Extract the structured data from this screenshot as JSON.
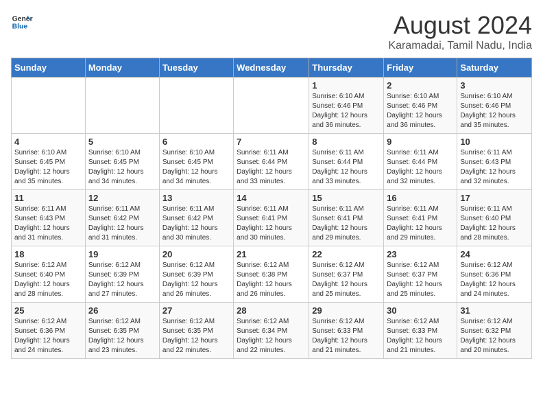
{
  "logo": {
    "line1": "General",
    "line2": "Blue"
  },
  "title": "August 2024",
  "subtitle": "Karamadai, Tamil Nadu, India",
  "days_of_week": [
    "Sunday",
    "Monday",
    "Tuesday",
    "Wednesday",
    "Thursday",
    "Friday",
    "Saturday"
  ],
  "weeks": [
    [
      {
        "day": "",
        "detail": ""
      },
      {
        "day": "",
        "detail": ""
      },
      {
        "day": "",
        "detail": ""
      },
      {
        "day": "",
        "detail": ""
      },
      {
        "day": "1",
        "detail": "Sunrise: 6:10 AM\nSunset: 6:46 PM\nDaylight: 12 hours\nand 36 minutes."
      },
      {
        "day": "2",
        "detail": "Sunrise: 6:10 AM\nSunset: 6:46 PM\nDaylight: 12 hours\nand 36 minutes."
      },
      {
        "day": "3",
        "detail": "Sunrise: 6:10 AM\nSunset: 6:46 PM\nDaylight: 12 hours\nand 35 minutes."
      }
    ],
    [
      {
        "day": "4",
        "detail": "Sunrise: 6:10 AM\nSunset: 6:45 PM\nDaylight: 12 hours\nand 35 minutes."
      },
      {
        "day": "5",
        "detail": "Sunrise: 6:10 AM\nSunset: 6:45 PM\nDaylight: 12 hours\nand 34 minutes."
      },
      {
        "day": "6",
        "detail": "Sunrise: 6:10 AM\nSunset: 6:45 PM\nDaylight: 12 hours\nand 34 minutes."
      },
      {
        "day": "7",
        "detail": "Sunrise: 6:11 AM\nSunset: 6:44 PM\nDaylight: 12 hours\nand 33 minutes."
      },
      {
        "day": "8",
        "detail": "Sunrise: 6:11 AM\nSunset: 6:44 PM\nDaylight: 12 hours\nand 33 minutes."
      },
      {
        "day": "9",
        "detail": "Sunrise: 6:11 AM\nSunset: 6:44 PM\nDaylight: 12 hours\nand 32 minutes."
      },
      {
        "day": "10",
        "detail": "Sunrise: 6:11 AM\nSunset: 6:43 PM\nDaylight: 12 hours\nand 32 minutes."
      }
    ],
    [
      {
        "day": "11",
        "detail": "Sunrise: 6:11 AM\nSunset: 6:43 PM\nDaylight: 12 hours\nand 31 minutes."
      },
      {
        "day": "12",
        "detail": "Sunrise: 6:11 AM\nSunset: 6:42 PM\nDaylight: 12 hours\nand 31 minutes."
      },
      {
        "day": "13",
        "detail": "Sunrise: 6:11 AM\nSunset: 6:42 PM\nDaylight: 12 hours\nand 30 minutes."
      },
      {
        "day": "14",
        "detail": "Sunrise: 6:11 AM\nSunset: 6:41 PM\nDaylight: 12 hours\nand 30 minutes."
      },
      {
        "day": "15",
        "detail": "Sunrise: 6:11 AM\nSunset: 6:41 PM\nDaylight: 12 hours\nand 29 minutes."
      },
      {
        "day": "16",
        "detail": "Sunrise: 6:11 AM\nSunset: 6:41 PM\nDaylight: 12 hours\nand 29 minutes."
      },
      {
        "day": "17",
        "detail": "Sunrise: 6:11 AM\nSunset: 6:40 PM\nDaylight: 12 hours\nand 28 minutes."
      }
    ],
    [
      {
        "day": "18",
        "detail": "Sunrise: 6:12 AM\nSunset: 6:40 PM\nDaylight: 12 hours\nand 28 minutes."
      },
      {
        "day": "19",
        "detail": "Sunrise: 6:12 AM\nSunset: 6:39 PM\nDaylight: 12 hours\nand 27 minutes."
      },
      {
        "day": "20",
        "detail": "Sunrise: 6:12 AM\nSunset: 6:39 PM\nDaylight: 12 hours\nand 26 minutes."
      },
      {
        "day": "21",
        "detail": "Sunrise: 6:12 AM\nSunset: 6:38 PM\nDaylight: 12 hours\nand 26 minutes."
      },
      {
        "day": "22",
        "detail": "Sunrise: 6:12 AM\nSunset: 6:37 PM\nDaylight: 12 hours\nand 25 minutes."
      },
      {
        "day": "23",
        "detail": "Sunrise: 6:12 AM\nSunset: 6:37 PM\nDaylight: 12 hours\nand 25 minutes."
      },
      {
        "day": "24",
        "detail": "Sunrise: 6:12 AM\nSunset: 6:36 PM\nDaylight: 12 hours\nand 24 minutes."
      }
    ],
    [
      {
        "day": "25",
        "detail": "Sunrise: 6:12 AM\nSunset: 6:36 PM\nDaylight: 12 hours\nand 24 minutes."
      },
      {
        "day": "26",
        "detail": "Sunrise: 6:12 AM\nSunset: 6:35 PM\nDaylight: 12 hours\nand 23 minutes."
      },
      {
        "day": "27",
        "detail": "Sunrise: 6:12 AM\nSunset: 6:35 PM\nDaylight: 12 hours\nand 22 minutes."
      },
      {
        "day": "28",
        "detail": "Sunrise: 6:12 AM\nSunset: 6:34 PM\nDaylight: 12 hours\nand 22 minutes."
      },
      {
        "day": "29",
        "detail": "Sunrise: 6:12 AM\nSunset: 6:33 PM\nDaylight: 12 hours\nand 21 minutes."
      },
      {
        "day": "30",
        "detail": "Sunrise: 6:12 AM\nSunset: 6:33 PM\nDaylight: 12 hours\nand 21 minutes."
      },
      {
        "day": "31",
        "detail": "Sunrise: 6:12 AM\nSunset: 6:32 PM\nDaylight: 12 hours\nand 20 minutes."
      }
    ]
  ]
}
